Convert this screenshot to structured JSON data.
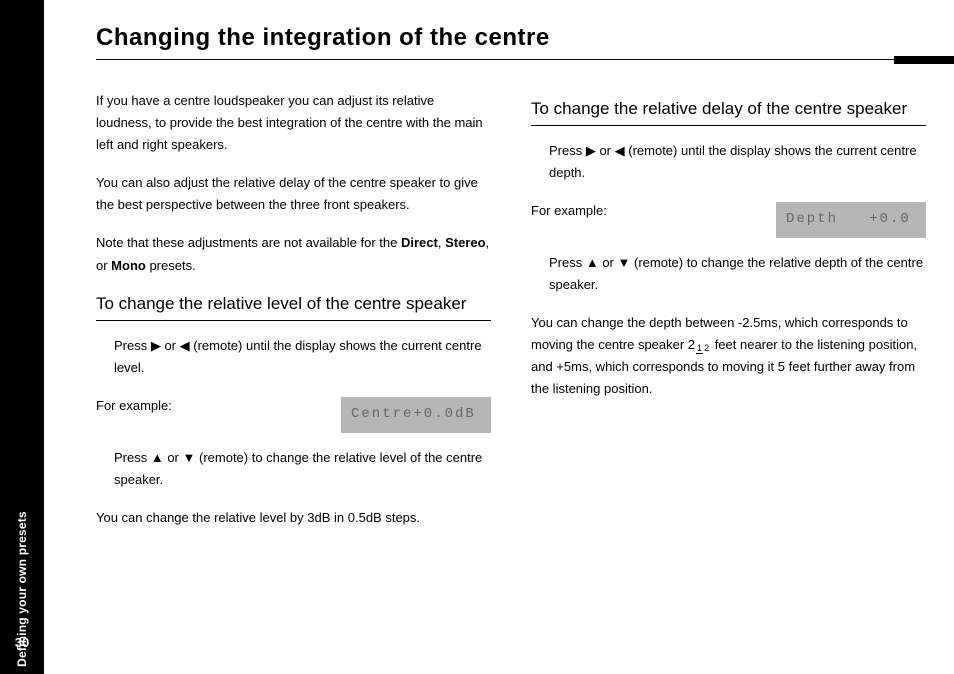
{
  "sidebar": {
    "section_label": "Defining your own presets",
    "page_number": "30"
  },
  "title": "Changing the integration of the centre",
  "col1": {
    "p1": "If you have a centre loudspeaker you can adjust its relative loudness, to provide the best integration of the centre with the main left and right speakers.",
    "p2": "You can also adjust the relative delay of the centre speaker to give the best perspective between the three front speakers.",
    "p3_a": "Note that these adjustments are not available for the ",
    "p3_b1": "Direct",
    "p3_c": ", ",
    "p3_b2": "Stereo",
    "p3_d": ", or ",
    "p3_b3": "Mono",
    "p3_e": " presets.",
    "h1": "To change the relative level of the centre speaker",
    "step1_a": "Press ",
    "step1_b": " or ",
    "step1_c": " (remote) until the display shows the current centre level.",
    "example_label": "For example:",
    "display1": "Centre+0.0dB",
    "step2_a": "Press ",
    "step2_b": " or ",
    "step2_c": " (remote) to change the relative level of the centre speaker.",
    "p4": "You can change the relative level by  3dB in 0.5dB steps."
  },
  "col2": {
    "h1": "To change the relative delay of the centre speaker",
    "step1_a": "Press ",
    "step1_b": " or ",
    "step1_c": " (remote) until the display shows the current centre depth.",
    "example_label": "For example:",
    "display1": "Depth   +0.0",
    "step2_a": "Press ",
    "step2_b": " or ",
    "step2_c": " (remote) to change the relative depth of the centre speaker.",
    "p1_a": "You can change the depth between -2.5ms, which corresponds to moving the centre speaker 2",
    "p1_frac_n": "1",
    "p1_frac_d": "2",
    "p1_b": " feet nearer to the listening position, and +5ms, which corresponds to moving it 5 feet further away from the listening position."
  },
  "glyphs": {
    "right": "▶",
    "left": "◀",
    "up": "▲",
    "down": "▼"
  }
}
